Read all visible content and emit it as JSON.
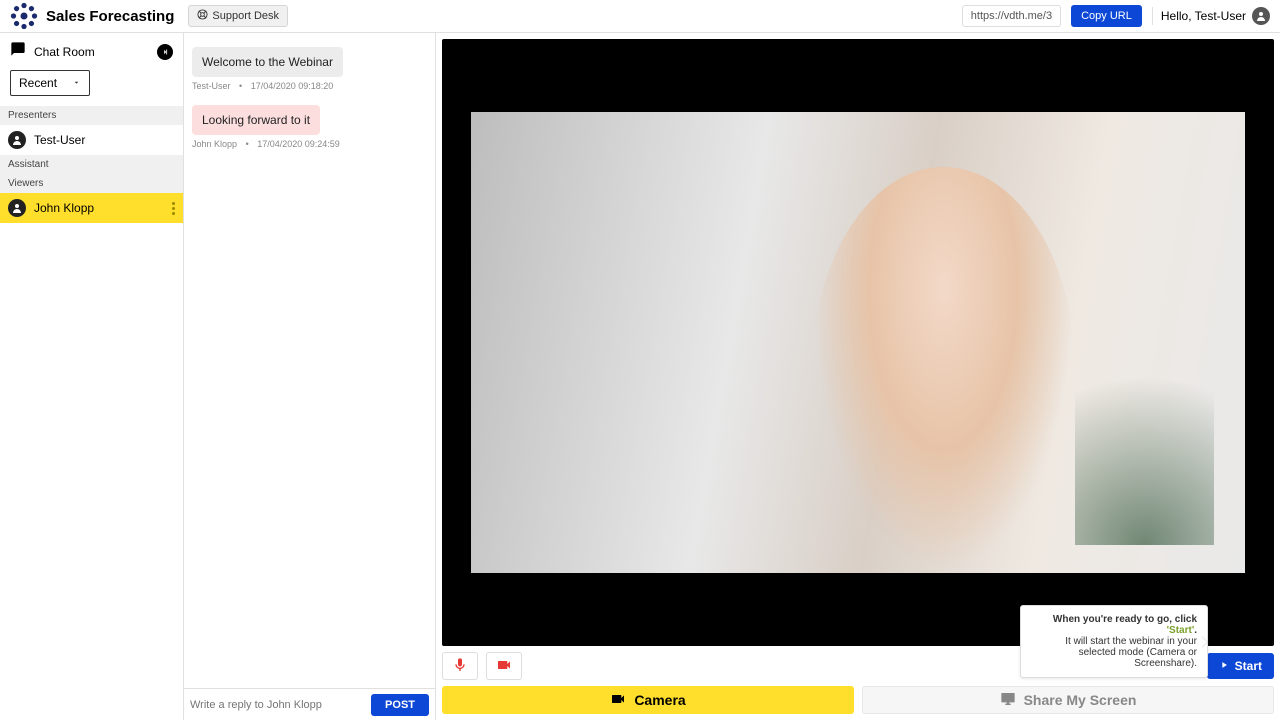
{
  "header": {
    "title": "Sales Forecasting",
    "support_label": "Support Desk",
    "url": "https://vdth.me/3",
    "copy_label": "Copy URL",
    "greeting": "Hello, Test-User"
  },
  "sidebar": {
    "chat_label": "Chat Room",
    "filter": "Recent",
    "sections": {
      "presenters": "Presenters",
      "assistant": "Assistant",
      "viewers": "Viewers"
    },
    "presenter_name": "Test-User",
    "viewer_name": "John Klopp"
  },
  "chat": {
    "messages": [
      {
        "text": "Welcome to the Webinar",
        "author": "Test-User",
        "time": "17/04/2020 09:18:20",
        "tone": "gray"
      },
      {
        "text": "Looking forward to it",
        "author": "John Klopp",
        "time": "17/04/2020 09:24:59",
        "tone": "pink"
      }
    ],
    "compose_placeholder": "Write a reply to John Klopp",
    "post_label": "POST"
  },
  "main": {
    "start_label": "Start",
    "tooltip_line1_a": "When you're ready to go, click ",
    "tooltip_line1_b": "'Start'",
    "tooltip_line1_c": ".",
    "tooltip_line2": "It will start the webinar in your selected mode (Camera or Screenshare).",
    "mode_camera": "Camera",
    "mode_screen": "Share My Screen"
  }
}
